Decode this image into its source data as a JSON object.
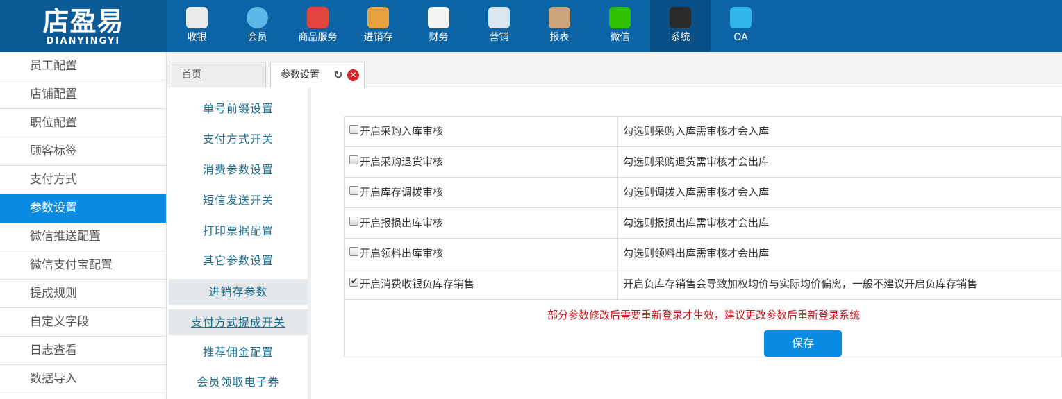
{
  "logo": {
    "cn": "店盈易",
    "en": "DIANYINGYI"
  },
  "nav": [
    {
      "label": "收银",
      "icon": "cash-register-icon",
      "color": "#eaeaea"
    },
    {
      "label": "会员",
      "icon": "member-icon",
      "color": "#5cb8e6"
    },
    {
      "label": "商品服务",
      "icon": "goods-icon",
      "color": "#e2453c"
    },
    {
      "label": "进销存",
      "icon": "inventory-icon",
      "color": "#e6a23c"
    },
    {
      "label": "财务",
      "icon": "finance-icon",
      "color": "#f4f4f4"
    },
    {
      "label": "营销",
      "icon": "megaphone-icon",
      "color": "#d9e6f2"
    },
    {
      "label": "报表",
      "icon": "report-icon",
      "color": "#c9a37a"
    },
    {
      "label": "微信",
      "icon": "wechat-icon",
      "color": "#2dc100"
    },
    {
      "label": "系统",
      "icon": "monitor-icon",
      "color": "#2b2b2b"
    },
    {
      "label": "OA",
      "icon": "oa-icon",
      "color": "#2fb5e8"
    }
  ],
  "sidebar": {
    "items": [
      "员工配置",
      "店铺配置",
      "职位配置",
      "顾客标签",
      "支付方式",
      "参数设置",
      "微信推送配置",
      "微信支付宝配置",
      "提成规则",
      "自定义字段",
      "日志查看",
      "数据导入"
    ],
    "active": "参数设置"
  },
  "tabs": {
    "home": "首页",
    "active": "参数设置"
  },
  "submenu": [
    "单号前缀设置",
    "支付方式开关",
    "消费参数设置",
    "短信发送开关",
    "打印票据配置",
    "其它参数设置",
    "进销存参数",
    "支付方式提成开关",
    "推荐佣金配置",
    "会员领取电子券"
  ],
  "params": [
    {
      "label": "开启采购入库审核",
      "desc": "勾选则采购入库需审核才会入库",
      "checked": false
    },
    {
      "label": "开启采购退货审核",
      "desc": "勾选则采购退货需审核才会出库",
      "checked": false
    },
    {
      "label": "开启库存调拨审核",
      "desc": "勾选则调拨入库需审核才会入库",
      "checked": false
    },
    {
      "label": "开启报损出库审核",
      "desc": "勾选则报损出库需审核才会出库",
      "checked": false
    },
    {
      "label": "开启领料出库审核",
      "desc": "勾选则领料出库需审核才会出库",
      "checked": false
    },
    {
      "label": "开启消费收银负库存销售",
      "desc": "开启负库存销售会导致加权均价与实际均价偏离，一般不建议开启负库存销售",
      "checked": true
    }
  ],
  "notice": "部分参数修改后需要重新登录才生效，建议更改参数后重新登录系统",
  "save_label": "保存"
}
